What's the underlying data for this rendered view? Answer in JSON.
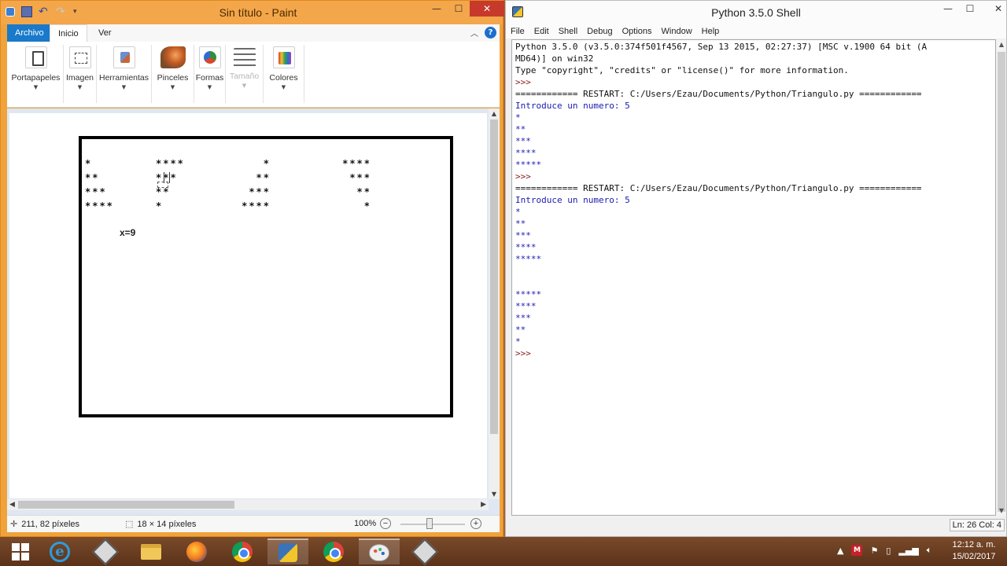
{
  "paint": {
    "title": "Sin título - Paint",
    "window_controls": {
      "minimize": "—",
      "maximize": "☐",
      "close": "✕"
    },
    "tabs": {
      "file": "Archivo",
      "home": "Inicio",
      "view": "Ver"
    },
    "help": "?",
    "ribbon_groups": [
      {
        "label": "Portapapeles",
        "icon": "clipboard-icon"
      },
      {
        "label": "Imagen",
        "icon": "select-icon"
      },
      {
        "label": "Herramientas",
        "icon": "tools-icon"
      },
      {
        "label": "Pinceles",
        "icon": "brush-icon"
      },
      {
        "label": "Formas",
        "icon": "shapes-icon"
      },
      {
        "label": "Tamaño",
        "icon": "size-icon",
        "disabled": true
      },
      {
        "label": "Colores",
        "icon": "colors-icon"
      }
    ],
    "canvas": {
      "pattern1": "*\n**\n***\n****",
      "pattern2": "****\n***\n**\n*",
      "pattern3": "*\n**\n***\n****",
      "pattern4": "****\n***\n**\n*",
      "label": "x=9"
    },
    "status": {
      "cursor_pos": "211, 82 píxeles",
      "selection_size": "18 × 14 píxeles",
      "zoom": "100%",
      "zoom_level": 1.0
    }
  },
  "shell": {
    "title": "Python 3.5.0 Shell",
    "window_controls": {
      "minimize": "—",
      "maximize": "☐",
      "close": "✕"
    },
    "menu": [
      "File",
      "Edit",
      "Shell",
      "Debug",
      "Options",
      "Window",
      "Help"
    ],
    "lines": [
      {
        "text": "Python 3.5.0 (v3.5.0:374f501f4567, Sep 13 2015, 02:27:37) [MSC v.1900 64 bit (A",
        "kind": "out"
      },
      {
        "text": "MD64)] on win32",
        "kind": "out"
      },
      {
        "text": "Type \"copyright\", \"credits\" or \"license()\" for more information.",
        "kind": "out"
      },
      {
        "text": ">>>",
        "kind": "prompt"
      },
      {
        "text": "============ RESTART: C:/Users/Ezau/Documents/Python/Triangulo.py ============",
        "kind": "out"
      },
      {
        "text": "Introduce un numero: 5",
        "kind": "star"
      },
      {
        "text": "*",
        "kind": "star"
      },
      {
        "text": "**",
        "kind": "star"
      },
      {
        "text": "***",
        "kind": "star"
      },
      {
        "text": "****",
        "kind": "star"
      },
      {
        "text": "*****",
        "kind": "star"
      },
      {
        "text": ">>>",
        "kind": "prompt"
      },
      {
        "text": "============ RESTART: C:/Users/Ezau/Documents/Python/Triangulo.py ============",
        "kind": "out"
      },
      {
        "text": "Introduce un numero: 5",
        "kind": "star"
      },
      {
        "text": "*",
        "kind": "star"
      },
      {
        "text": "**",
        "kind": "star"
      },
      {
        "text": "***",
        "kind": "star"
      },
      {
        "text": "****",
        "kind": "star"
      },
      {
        "text": "*****",
        "kind": "star"
      },
      {
        "text": "",
        "kind": "out"
      },
      {
        "text": "",
        "kind": "out"
      },
      {
        "text": "*****",
        "kind": "star"
      },
      {
        "text": "****",
        "kind": "star"
      },
      {
        "text": "***",
        "kind": "star"
      },
      {
        "text": "**",
        "kind": "star"
      },
      {
        "text": "*",
        "kind": "star"
      },
      {
        "text": ">>>",
        "kind": "prompt"
      }
    ],
    "status": "Ln: 26 Col: 4"
  },
  "taskbar": {
    "apps": [
      "start",
      "internet-explorer",
      "app-window",
      "file-explorer",
      "firefox",
      "chrome",
      "python-idle",
      "chrome",
      "paint",
      "app-window"
    ],
    "clock_time": "12:12 a. m.",
    "clock_date": "15/02/2017"
  },
  "colors": {
    "paint_title": "#f3a64a",
    "shell_prompt": "#8a1a1a",
    "shell_output_blue": "#1a1ab0",
    "taskbar": "#5a321a"
  }
}
